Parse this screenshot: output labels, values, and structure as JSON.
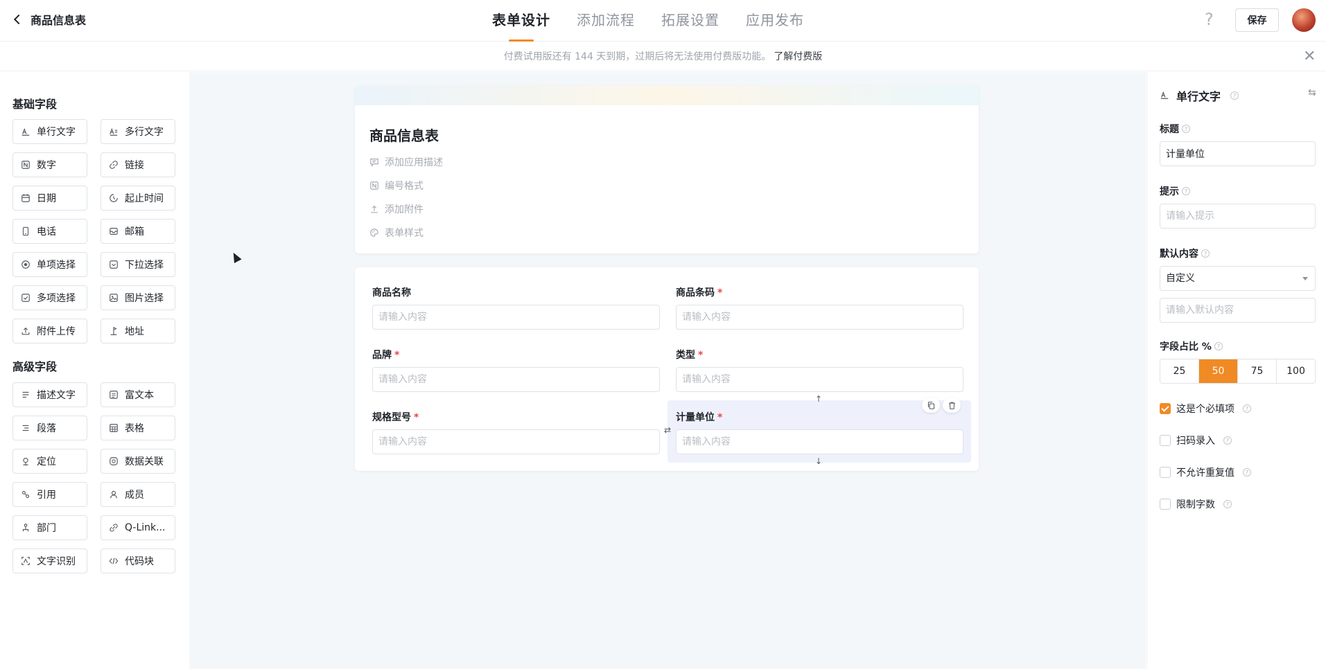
{
  "header": {
    "back_title": "商品信息表",
    "tabs": [
      {
        "label": "表单设计"
      },
      {
        "label": "添加流程"
      },
      {
        "label": "拓展设置"
      },
      {
        "label": "应用发布"
      }
    ],
    "help_glyph": "?",
    "save_label": "保存",
    "accent_color": "#f08a24"
  },
  "notice": {
    "text": "付费试用版还有 144 天到期，过期后将无法使用付费版功能。",
    "link": "了解付费版"
  },
  "left_panel": {
    "basic_title": "基础字段",
    "basic_fields": [
      {
        "label": "单行文字",
        "icon": "text-icon"
      },
      {
        "label": "多行文字",
        "icon": "multiline-text-icon"
      },
      {
        "label": "数字",
        "icon": "number-icon"
      },
      {
        "label": "链接",
        "icon": "link-icon"
      },
      {
        "label": "日期",
        "icon": "calendar-icon"
      },
      {
        "label": "起止时间",
        "icon": "time-range-icon"
      },
      {
        "label": "电话",
        "icon": "phone-icon"
      },
      {
        "label": "邮箱",
        "icon": "mail-icon"
      },
      {
        "label": "单项选择",
        "icon": "radio-icon"
      },
      {
        "label": "下拉选择",
        "icon": "dropdown-icon"
      },
      {
        "label": "多项选择",
        "icon": "checkbox-icon"
      },
      {
        "label": "图片选择",
        "icon": "image-icon"
      },
      {
        "label": "附件上传",
        "icon": "upload-icon"
      },
      {
        "label": "地址",
        "icon": "address-icon"
      }
    ],
    "advanced_title": "高级字段",
    "advanced_fields": [
      {
        "label": "描述文字",
        "icon": "description-icon"
      },
      {
        "label": "富文本",
        "icon": "rich-text-icon"
      },
      {
        "label": "段落",
        "icon": "paragraph-icon"
      },
      {
        "label": "表格",
        "icon": "table-icon"
      },
      {
        "label": "定位",
        "icon": "location-icon"
      },
      {
        "label": "数据关联",
        "icon": "data-link-icon"
      },
      {
        "label": "引用",
        "icon": "reference-icon"
      },
      {
        "label": "成员",
        "icon": "member-icon"
      },
      {
        "label": "部门",
        "icon": "department-icon"
      },
      {
        "label": "Q-Link...",
        "icon": "qlink-icon"
      },
      {
        "label": "文字识别",
        "icon": "ocr-icon"
      },
      {
        "label": "代码块",
        "icon": "code-icon"
      }
    ]
  },
  "form": {
    "name": "商品信息表",
    "options": [
      {
        "label": "添加应用描述",
        "icon": "comment-icon"
      },
      {
        "label": "编号格式",
        "icon": "number-format-icon"
      },
      {
        "label": "添加附件",
        "icon": "upload-icon"
      },
      {
        "label": "表单样式",
        "icon": "palette-icon"
      }
    ],
    "fields": [
      {
        "label": "商品名称",
        "required": false,
        "placeholder": "请输入内容"
      },
      {
        "label": "商品条码",
        "required": true,
        "placeholder": "请输入内容"
      },
      {
        "label": "品牌",
        "required": true,
        "placeholder": "请输入内容"
      },
      {
        "label": "类型",
        "required": true,
        "placeholder": "请输入内容"
      },
      {
        "label": "规格型号",
        "required": true,
        "placeholder": "请输入内容"
      },
      {
        "label": "计量单位",
        "required": true,
        "placeholder": "请输入内容"
      }
    ],
    "required_mark": "*"
  },
  "right_panel": {
    "field_type": "单行文字",
    "title_label": "标题",
    "title_value": "计量单位",
    "hint_label": "提示",
    "hint_placeholder": "请输入提示",
    "default_label": "默认内容",
    "default_mode": "自定义",
    "default_placeholder": "请输入默认内容",
    "ratio_label": "字段占比 %",
    "ratio_options": [
      "25",
      "50",
      "75",
      "100"
    ],
    "ratio_selected": "50",
    "checkboxes": [
      {
        "label": "这是个必填项",
        "checked": true
      },
      {
        "label": "扫码录入",
        "checked": false
      },
      {
        "label": "不允许重复值",
        "checked": false
      },
      {
        "label": "限制字数",
        "checked": false
      }
    ]
  }
}
